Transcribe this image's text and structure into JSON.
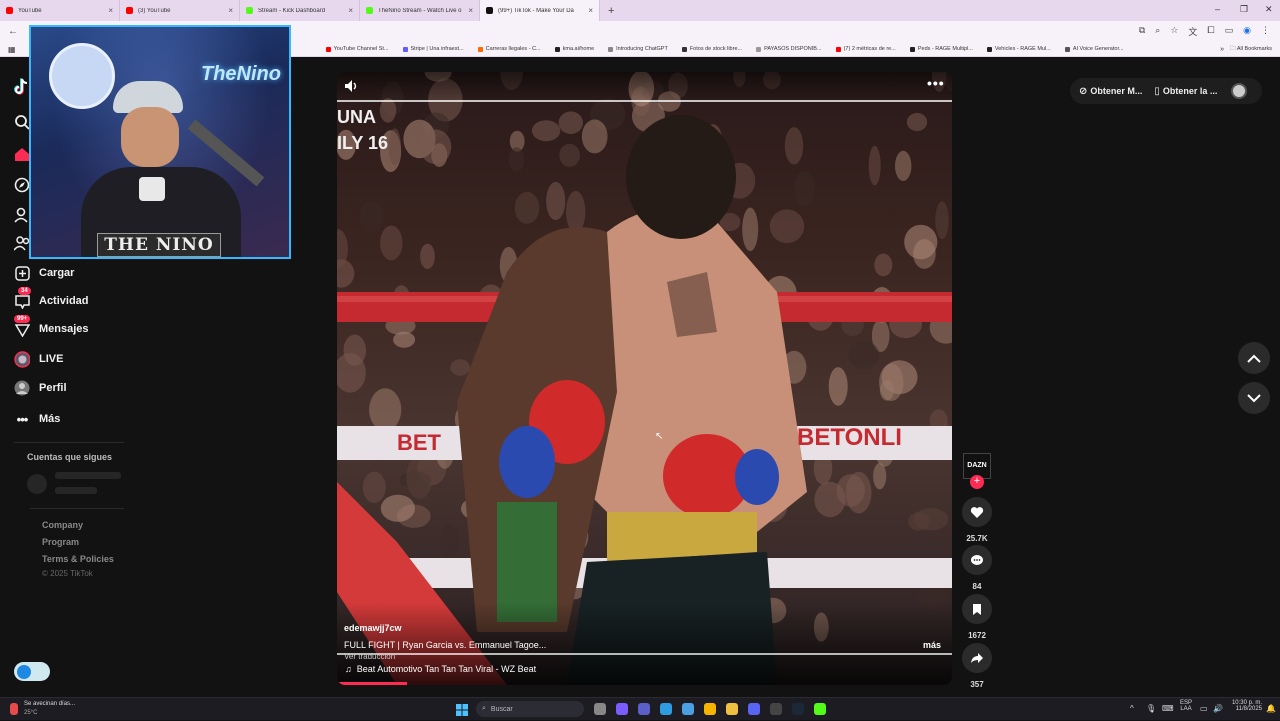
{
  "browser": {
    "tabs": [
      {
        "title": "YouTube",
        "color": "#ff0000",
        "active": false
      },
      {
        "title": "(3) YouTube",
        "color": "#ff0000",
        "active": false
      },
      {
        "title": "Stream - Kick Dashboard",
        "color": "#53fc18",
        "active": false
      },
      {
        "title": "TheNino Stream - Watch Live o",
        "color": "#53fc18",
        "active": false
      },
      {
        "title": "(99+) TikTok - Make Your Da",
        "color": "#111111",
        "active": true
      }
    ],
    "new_tab_label": "+",
    "bookmarks": [
      {
        "label": "YouTube Channel St...",
        "color": "#ff0000"
      },
      {
        "label": "Stripe | Una infraest...",
        "color": "#635bff"
      },
      {
        "label": "Carreras llegales - C...",
        "color": "#ff6a00"
      },
      {
        "label": "kma.ai/home",
        "color": "#222222"
      },
      {
        "label": "Introducing ChatGPT",
        "color": "#888888"
      },
      {
        "label": "Fotos de stock libre...",
        "color": "#333333"
      },
      {
        "label": "PAYASOS DISPONIB...",
        "color": "#999999"
      },
      {
        "label": "(7) 2 métricas de re...",
        "color": "#ff0000"
      },
      {
        "label": "Peds - RAGE Multipl...",
        "color": "#222222"
      },
      {
        "label": "Vehicles - RAGE Mul...",
        "color": "#222222"
      },
      {
        "label": "AI Voice Generator...",
        "color": "#555555"
      }
    ],
    "all_bookmarks_label": "All Bookmarks"
  },
  "sidebar": {
    "items": [
      {
        "label": "Cargar",
        "icon": "plus-square-icon"
      },
      {
        "label": "Actividad",
        "icon": "inbox-icon",
        "badge": "34"
      },
      {
        "label": "Mensajes",
        "icon": "message-icon",
        "badge": "99+"
      },
      {
        "label": "LIVE",
        "icon": "live-icon"
      },
      {
        "label": "Perfil",
        "icon": "avatar-icon"
      },
      {
        "label": "Más",
        "icon": "more-icon"
      }
    ],
    "following_title": "Cuentas que sigues",
    "footer_links": [
      "Company",
      "Program",
      "Terms & Policies"
    ],
    "copyright": "© 2025 TikTok"
  },
  "webcam": {
    "overlay_name": "THE NINO",
    "neon_text": "TheNino"
  },
  "video": {
    "overlay_top_lines": [
      "UNA",
      "ILY 16"
    ],
    "ring_ads": [
      "BET",
      "BETONLI"
    ],
    "author": "edemawjj7cw",
    "caption": "FULL FIGHT | Ryan Garcia vs. Emmanuel Tagoe...",
    "more_label": "más",
    "translate_label": "Ver traducción",
    "music": "Beat Automotivo Tan Tan Tan Viral - WZ Beat",
    "menu_icon": "more-horizontal-icon",
    "mute_icon": "volume-icon"
  },
  "actions": {
    "profile_badge": "DAZN",
    "likes": "25.7K",
    "comments": "84",
    "saves": "1672",
    "shares": "357"
  },
  "top_right": {
    "btn1": "Obtener M...",
    "btn2": "Obtener la ..."
  },
  "taskbar": {
    "weather_title": "Se avecinan días...",
    "weather_temp": "25°C",
    "search_placeholder": "Buscar",
    "lang_top": "ESP",
    "lang_bottom": "LAA",
    "time": "10:30 p. m.",
    "date": "11/8/2025"
  }
}
